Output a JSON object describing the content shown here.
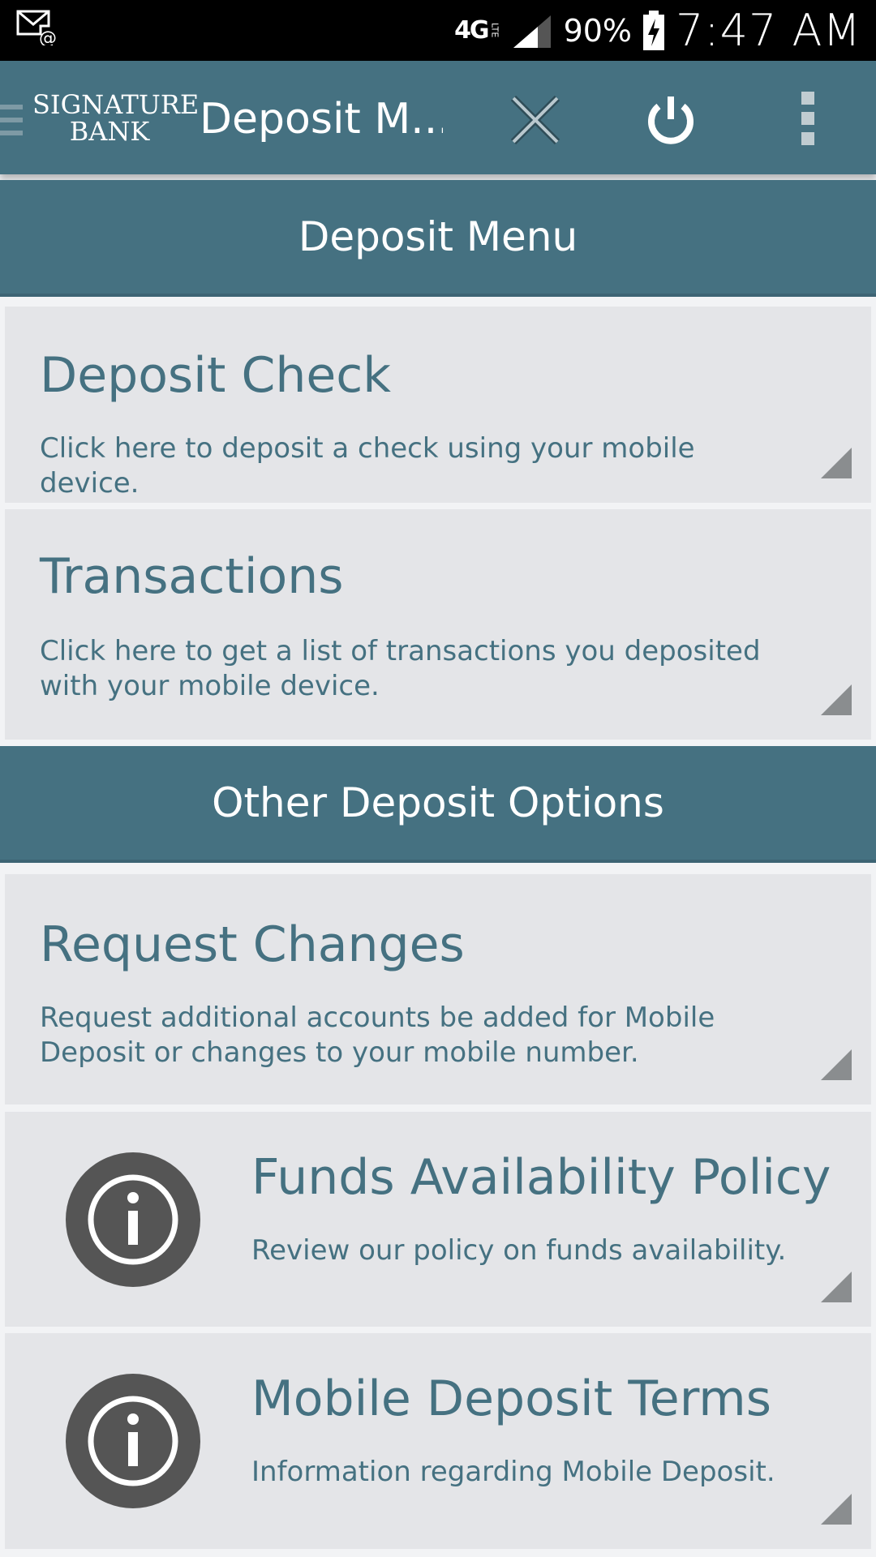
{
  "status_bar": {
    "network": "4G",
    "network_sub": "LTE",
    "battery": "90%",
    "time": "7:47 AM",
    "icons": [
      "email-notification-icon",
      "signal-icon",
      "battery-charging-icon"
    ]
  },
  "app_bar": {
    "logo_line1": "SIGNATURE",
    "logo_line2": "BANK",
    "title": "Deposit M...",
    "icons": [
      "hamburger-icon",
      "close-icon",
      "power-icon",
      "more-vertical-icon"
    ]
  },
  "sections": [
    {
      "header": "Deposit Menu",
      "items": [
        {
          "title": "Deposit Check",
          "description": "Click here to deposit a check using your mobile device."
        },
        {
          "title": "Transactions",
          "description": "Click here to get a list of transactions you deposited with your mobile device."
        }
      ]
    },
    {
      "header": "Other Deposit Options",
      "items": [
        {
          "title": "Request Changes",
          "description": "Request additional accounts be added for Mobile Deposit or changes to your mobile number."
        },
        {
          "title": "Funds Availability Policy",
          "description": "Review our policy on funds availability.",
          "icon": "info-icon"
        },
        {
          "title": "Mobile Deposit Terms",
          "description": "Information regarding Mobile Deposit.",
          "icon": "info-icon"
        }
      ]
    }
  ],
  "colors": {
    "primary": "#457181",
    "card": "#e4e5e8",
    "info_icon": "#555555",
    "corner": "#8a8d8f"
  }
}
